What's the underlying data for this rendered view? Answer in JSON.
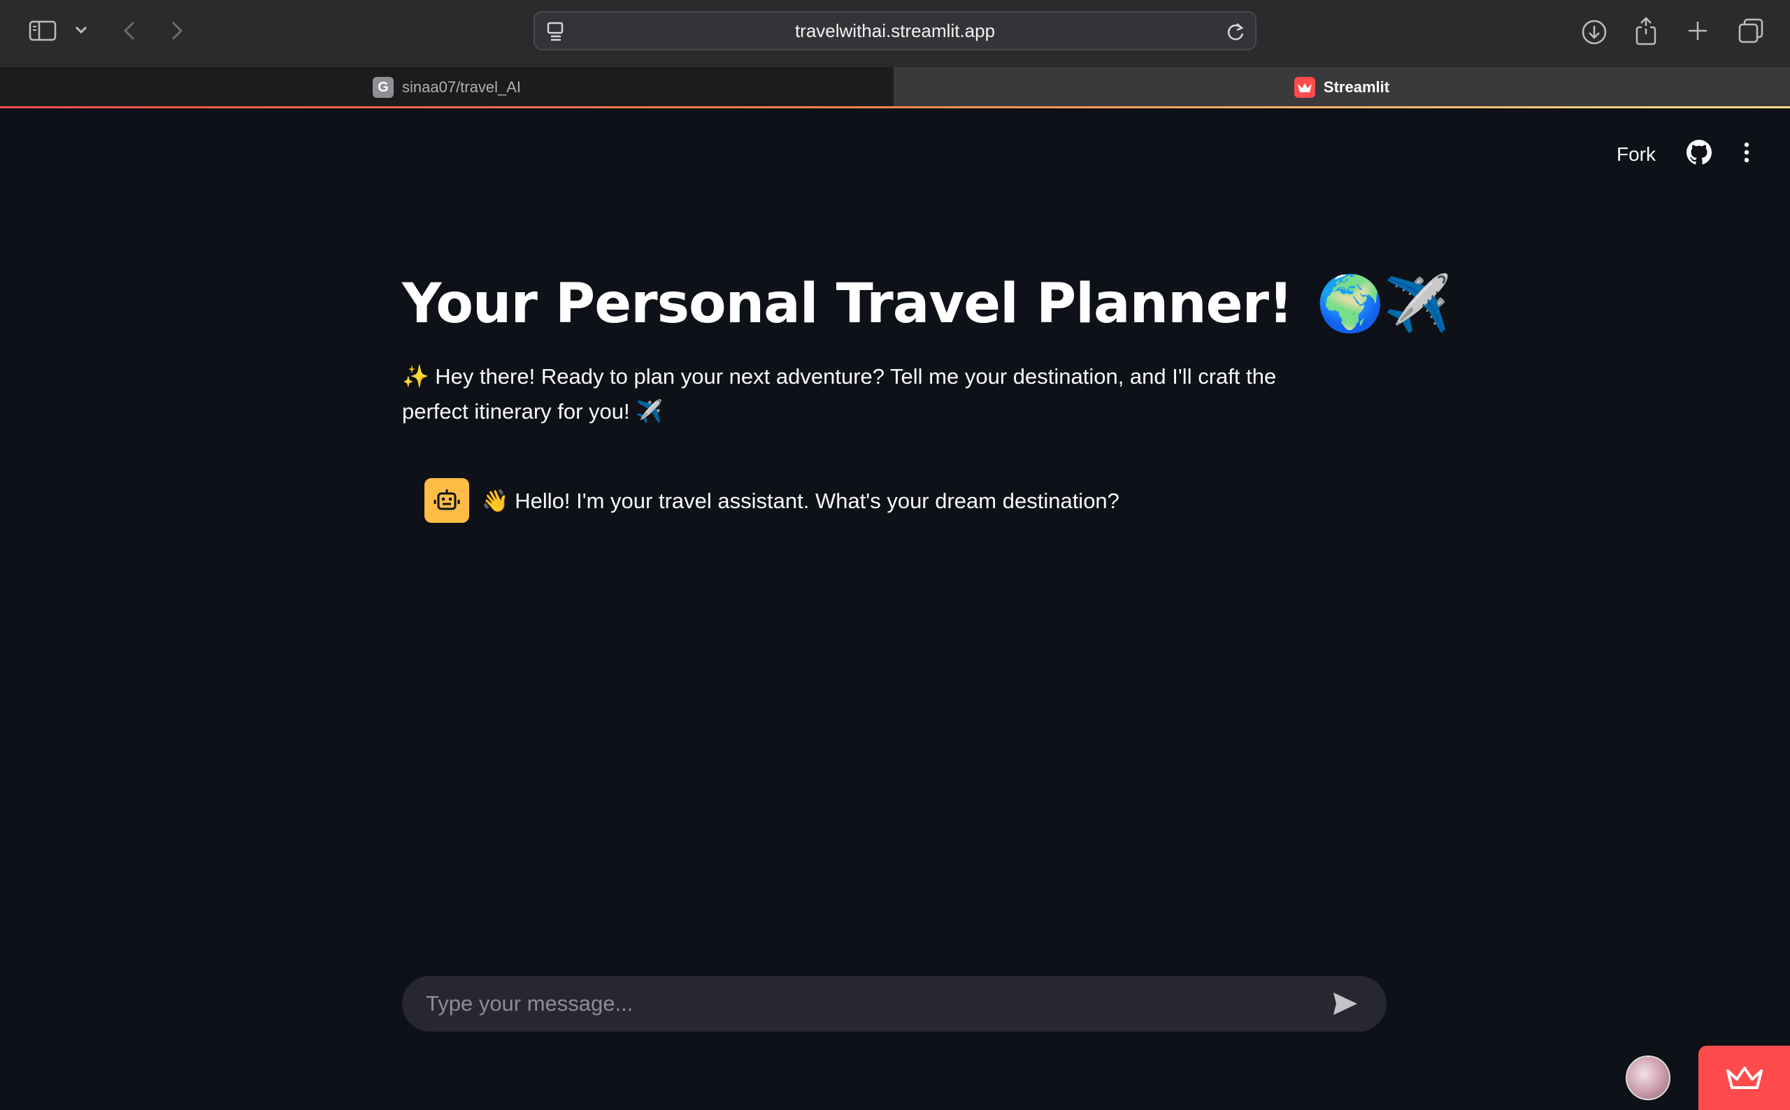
{
  "browser": {
    "url": "travelwithai.streamlit.app",
    "tabs": [
      {
        "label": "sinaa07/travel_AI",
        "favicon": "G"
      },
      {
        "label": "Streamlit"
      }
    ]
  },
  "header": {
    "fork_label": "Fork"
  },
  "main": {
    "title": "Your Personal Travel Planner!",
    "title_emoji": "🌍✈️",
    "intro": "✨ Hey there! Ready to plan your next adventure? Tell me your destination, and I'll craft the perfect itinerary for you! ✈️"
  },
  "chat": {
    "messages": [
      {
        "role": "assistant",
        "text": "👋 Hello! I'm your travel assistant. What's your dream destination?"
      }
    ],
    "input_placeholder": "Type your message..."
  },
  "colors": {
    "background": "#0e1117",
    "accent": "#ff4b4b",
    "bot_avatar": "#ffbd45"
  }
}
